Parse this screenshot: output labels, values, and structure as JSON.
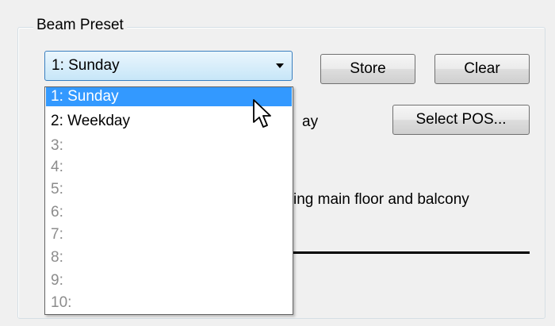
{
  "beam_preset": {
    "group_title": "Beam Preset",
    "combo_selected": "1: Sunday",
    "store_label": "Store",
    "clear_label": "Clear",
    "select_pos_label": "Select POS...",
    "partial_text_1": "ay",
    "partial_text_2": "ing main floor and balcony",
    "options": [
      {
        "label": "1: Sunday",
        "state": "selected"
      },
      {
        "label": "2: Weekday",
        "state": "enabled"
      },
      {
        "label": "3:",
        "state": "disabled"
      },
      {
        "label": "4:",
        "state": "disabled"
      },
      {
        "label": "5:",
        "state": "disabled"
      },
      {
        "label": "6:",
        "state": "disabled"
      },
      {
        "label": "7:",
        "state": "disabled"
      },
      {
        "label": "8:",
        "state": "disabled"
      },
      {
        "label": "9:",
        "state": "disabled"
      },
      {
        "label": "10:",
        "state": "disabled"
      }
    ]
  },
  "colors": {
    "selection": "#3399ff",
    "disabled_text": "#8c8c8c",
    "combo_border": "#3a7fbf"
  }
}
